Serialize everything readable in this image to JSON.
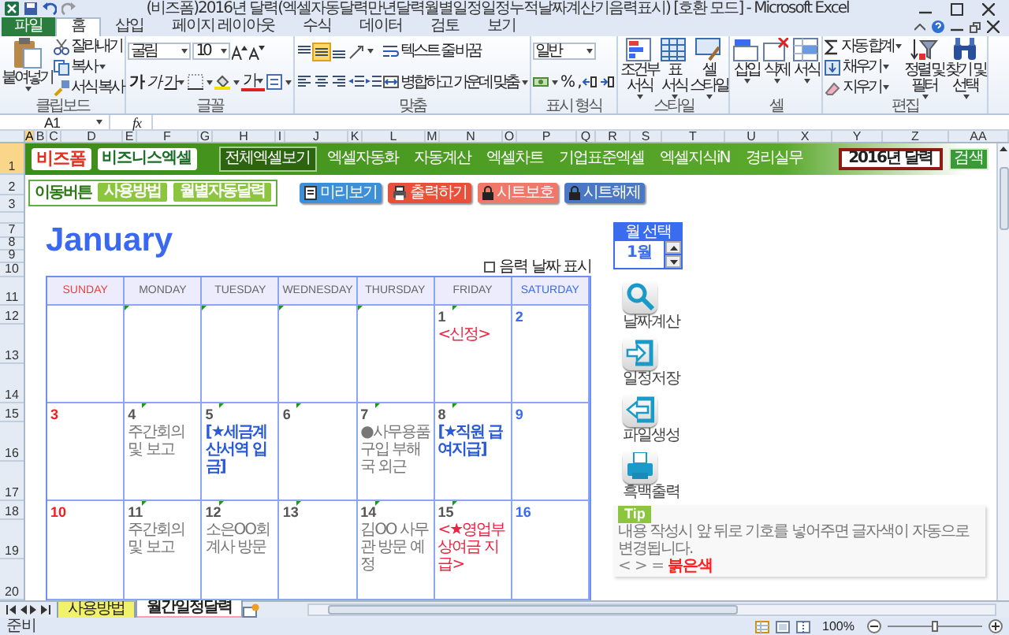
{
  "title_bar": {
    "title": "(비즈폼)2016년 달력(엑셀자동달력만년달력월별일정일정누적날짜계산기음력표시) [호환 모드] - Microsoft Excel"
  },
  "ribbon": {
    "tabs": [
      {
        "label": "파일",
        "kind": "file",
        "selected": false
      },
      {
        "label": "홈",
        "kind": "tab",
        "selected": true
      },
      {
        "label": "삽입",
        "kind": "tab",
        "selected": false
      },
      {
        "label": "페이지 레이아웃",
        "kind": "tab",
        "selected": false
      },
      {
        "label": "수식",
        "kind": "tab",
        "selected": false
      },
      {
        "label": "데이터",
        "kind": "tab",
        "selected": false
      },
      {
        "label": "검토",
        "kind": "tab",
        "selected": false
      },
      {
        "label": "보기",
        "kind": "tab",
        "selected": false
      }
    ],
    "groups": [
      {
        "label": "클립보드",
        "columns": [
          {
            "kind": "large",
            "label": "붙여넣기",
            "dropdown": true
          },
          {
            "kind": "stack",
            "lines": [
              {
                "items": [
                  {
                    "kind": "button",
                    "label": "잘라내기"
                  }
                ]
              },
              {
                "items": [
                  {
                    "kind": "button",
                    "label": "복사",
                    "dropdown": true
                  }
                ]
              },
              {
                "items": [
                  {
                    "kind": "button",
                    "label": "서식 복사"
                  }
                ]
              }
            ]
          }
        ]
      },
      {
        "label": "글꼴",
        "columns": [
          {
            "kind": "stack",
            "lines": [
              {
                "items": [
                  {
                    "kind": "field",
                    "value": "굴림",
                    "dropdown": true
                  },
                  {
                    "kind": "field",
                    "value": "10",
                    "dropdown": true
                  },
                  {
                    "kind": "icon"
                  },
                  {
                    "kind": "icon"
                  }
                ]
              },
              {
                "items": [
                  {
                    "kind": "bold",
                    "label": "가"
                  },
                  {
                    "kind": "italic",
                    "label": "가"
                  },
                  {
                    "kind": "underline",
                    "label": "가",
                    "dropdown": true
                  },
                  {
                    "kind": "icon",
                    "dropdown": true
                  },
                  {
                    "kind": "icon",
                    "dropdown": true
                  },
                  {
                    "kind": "font-color",
                    "label": "가",
                    "dropdown": true
                  },
                  {
                    "kind": "icon",
                    "dropdown": true
                  }
                ]
              }
            ]
          }
        ]
      },
      {
        "label": "맞춤",
        "columns": [
          {
            "kind": "stack",
            "lines": [
              {
                "items": [
                  {
                    "kind": "icon",
                    "selected": false
                  },
                  {
                    "kind": "icon",
                    "selected": true
                  },
                  {
                    "kind": "icon",
                    "selected": false
                  },
                  {
                    "kind": "icon",
                    "dropdown": true
                  }
                ]
              },
              {
                "items": [
                  {
                    "kind": "icon",
                    "selected": false
                  },
                  {
                    "kind": "icon",
                    "selected": false
                  },
                  {
                    "kind": "icon",
                    "selected": false
                  },
                  {
                    "kind": "icon"
                  },
                  {
                    "kind": "icon"
                  }
                ]
              }
            ]
          },
          {
            "kind": "stack",
            "lines": [
              {
                "items": [
                  {
                    "kind": "button",
                    "label": "텍스트 줄 바꿈"
                  }
                ]
              },
              {
                "items": [
                  {
                    "kind": "button",
                    "label": "병합하고 가운데 맞춤",
                    "dropdown": true
                  }
                ]
              }
            ]
          }
        ]
      },
      {
        "label": "표시 형식",
        "columns": [
          {
            "kind": "stack",
            "lines": [
              {
                "items": [
                  {
                    "kind": "field",
                    "value": "일반",
                    "dropdown": true
                  }
                ]
              },
              {
                "items": [
                  {
                    "kind": "icon",
                    "dropdown": true
                  },
                  {
                    "kind": "text",
                    "label": "%"
                  },
                  {
                    "kind": "text",
                    "label": ","
                  },
                  {
                    "kind": "icon"
                  },
                  {
                    "kind": "icon"
                  }
                ]
              }
            ]
          }
        ]
      },
      {
        "label": "스타일",
        "columns": [
          {
            "kind": "large",
            "label": "조건부 서식",
            "dropdown": true
          },
          {
            "kind": "large",
            "label": "표 서식",
            "dropdown": true
          },
          {
            "kind": "large",
            "label": "셀 스타일",
            "dropdown": true
          }
        ]
      },
      {
        "label": "셀",
        "columns": [
          {
            "kind": "large",
            "label": "삽입",
            "dropdown": true
          },
          {
            "kind": "large",
            "label": "삭제",
            "dropdown": true
          },
          {
            "kind": "large",
            "label": "서식",
            "dropdown": true
          }
        ]
      },
      {
        "label": "편집",
        "columns": [
          {
            "kind": "stack",
            "lines": [
              {
                "items": [
                  {
                    "kind": "button",
                    "label": "자동 합계",
                    "dropdown": true
                  }
                ]
              },
              {
                "items": [
                  {
                    "kind": "button",
                    "label": "채우기",
                    "dropdown": true
                  }
                ]
              },
              {
                "items": [
                  {
                    "kind": "button",
                    "label": "지우기",
                    "dropdown": true
                  }
                ]
              }
            ]
          },
          {
            "kind": "large",
            "label": "정렬 및 필터",
            "dropdown": true
          },
          {
            "kind": "large",
            "label": "찾기 및 선택",
            "dropdown": true
          }
        ]
      }
    ]
  },
  "formula_bar": {
    "name_box": "A1",
    "function_label": "fx"
  },
  "sheet": {
    "columns": [
      {
        "label": "A",
        "selected": true
      },
      {
        "label": "B",
        "selected": false
      },
      {
        "label": "C",
        "selected": false
      },
      {
        "label": "D",
        "selected": false
      },
      {
        "label": "E",
        "selected": false
      },
      {
        "label": "F",
        "selected": false
      },
      {
        "label": "G",
        "selected": false
      },
      {
        "label": "H",
        "selected": false
      },
      {
        "label": "I",
        "selected": false
      },
      {
        "label": "J",
        "selected": false
      },
      {
        "label": "K",
        "selected": false
      },
      {
        "label": "L",
        "selected": false
      },
      {
        "label": "M",
        "selected": false
      },
      {
        "label": "N",
        "selected": false
      },
      {
        "label": "O",
        "selected": false
      },
      {
        "label": "P",
        "selected": false
      },
      {
        "label": "Q",
        "selected": false
      },
      {
        "label": "R",
        "selected": false
      },
      {
        "label": "S",
        "selected": false
      },
      {
        "label": "T",
        "selected": false
      },
      {
        "label": "U",
        "selected": false
      },
      {
        "label": "X",
        "selected": false
      },
      {
        "label": "Y",
        "selected": false
      },
      {
        "label": "Z",
        "selected": false
      },
      {
        "label": "AA",
        "selected": false
      }
    ],
    "rows": [
      {
        "label": "1",
        "selected": true
      },
      {
        "label": "2",
        "selected": false
      },
      {
        "label": "3",
        "selected": false
      },
      {
        "label": "7",
        "selected": false
      },
      {
        "label": "8",
        "selected": false
      },
      {
        "label": "9",
        "selected": false
      },
      {
        "label": "10",
        "selected": false
      },
      {
        "label": "11",
        "selected": false
      },
      {
        "label": "12",
        "selected": false
      },
      {
        "label": "13",
        "selected": false
      },
      {
        "label": "14",
        "selected": false
      },
      {
        "label": "15",
        "selected": false
      },
      {
        "label": "16",
        "selected": false
      },
      {
        "label": "17",
        "selected": false
      },
      {
        "label": "18",
        "selected": false
      },
      {
        "label": "19",
        "selected": false
      },
      {
        "label": "20",
        "selected": false
      }
    ]
  },
  "banner": {
    "logo": "비즈폼",
    "brand": "비즈니스엑셀",
    "menu": [
      {
        "label": "전체엑셀보기",
        "selected": true
      },
      {
        "label": "엑셀자동화",
        "selected": false
      },
      {
        "label": "자동계산",
        "selected": false
      },
      {
        "label": "엑셀차트",
        "selected": false
      },
      {
        "label": "기업표준엑셀",
        "selected": false
      },
      {
        "label": "엑셀지식iN",
        "selected": false
      },
      {
        "label": "경리실무",
        "selected": false
      }
    ],
    "search": {
      "value": "2016년 달력",
      "button": "검색"
    }
  },
  "nav_box": {
    "label": "이동버튼",
    "buttons": [
      "사용방법",
      "월별자동달력"
    ]
  },
  "sheet_buttons": [
    {
      "label": "미리보기",
      "color": "#3d8fd8"
    },
    {
      "label": "출력하기",
      "color": "#e8503a"
    },
    {
      "label": "시트보호",
      "color": "#f07868"
    },
    {
      "label": "시트해제",
      "color": "#4a78c4"
    }
  ],
  "calendar": {
    "month": "January",
    "lunar_toggle": {
      "label": "음력 날짜 표시",
      "checked": false
    },
    "weekdays": [
      {
        "label": "SUNDAY",
        "kind": "sunday"
      },
      {
        "label": "MONDAY",
        "kind": "weekday"
      },
      {
        "label": "TUESDAY",
        "kind": "weekday"
      },
      {
        "label": "WEDNESDAY",
        "kind": "weekday"
      },
      {
        "label": "THURSDAY",
        "kind": "weekday"
      },
      {
        "label": "FRIDAY",
        "kind": "weekday"
      },
      {
        "label": "SATURDAY",
        "kind": "saturday"
      }
    ],
    "weeks": [
      [
        {
          "marked": false
        },
        {
          "marked": true
        },
        {
          "marked": true
        },
        {
          "marked": true
        },
        {
          "marked": true
        },
        {
          "date": "1",
          "marked": true,
          "note": {
            "text": "<신정>",
            "kind": "holiday"
          }
        },
        {
          "date": "2",
          "marked": false
        }
      ],
      [
        {
          "date": "3",
          "marked": false
        },
        {
          "date": "4",
          "marked": true,
          "note": {
            "text": "주간회의 및 보고",
            "kind": "plain"
          }
        },
        {
          "date": "5",
          "marked": true,
          "note": {
            "text": "[★세금계산서역 입금]",
            "kind": "important"
          }
        },
        {
          "date": "6",
          "marked": true
        },
        {
          "date": "7",
          "marked": true,
          "note": {
            "text": "●사무용품구입 부해국 외근",
            "kind": "plain"
          }
        },
        {
          "date": "8",
          "marked": true,
          "note": {
            "text": "[★직원 급여지급]",
            "kind": "important"
          }
        },
        {
          "date": "9",
          "marked": false
        }
      ],
      [
        {
          "date": "10",
          "marked": false
        },
        {
          "date": "11",
          "marked": true,
          "note": {
            "text": "주간회의 및 보고",
            "kind": "plain"
          }
        },
        {
          "date": "12",
          "marked": true,
          "note": {
            "text": "소은OO회계사 방문",
            "kind": "plain"
          }
        },
        {
          "date": "13",
          "marked": true
        },
        {
          "date": "14",
          "marked": true,
          "note": {
            "text": "김OO 사무관 방문 예정",
            "kind": "plain"
          }
        },
        {
          "date": "15",
          "marked": true,
          "note": {
            "text": "<★영업부 상여금 지급>",
            "kind": "holiday"
          }
        },
        {
          "date": "16",
          "marked": false
        }
      ]
    ]
  },
  "month_picker": {
    "title": "월 선택",
    "value": "1월"
  },
  "actions": [
    {
      "label": "날짜계산"
    },
    {
      "label": "일정저장"
    },
    {
      "label": "파일생성"
    },
    {
      "label": "흑백출력"
    }
  ],
  "tip": {
    "title": "Tip",
    "text": "내용 작성시 앞 뒤로 기호를 넣어주면 글자색이 자동으로 변경됩니다.",
    "legend": {
      "symbol": "< > =",
      "color_name": "붉은색",
      "color": "#ff2020"
    }
  },
  "sheet_tabs": [
    {
      "label": "사용방법",
      "selected": false,
      "color": "#f2f26a"
    },
    {
      "label": "월간일정달력",
      "selected": true
    }
  ],
  "status_bar": {
    "text": "준비",
    "zoom": "100%",
    "zoom_slider": {
      "level": 0.5
    }
  }
}
